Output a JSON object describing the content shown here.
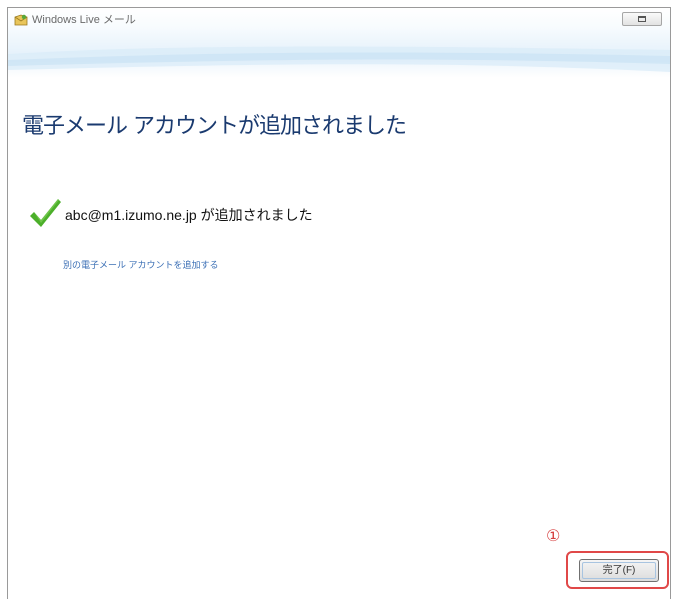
{
  "window": {
    "title": "Windows Live メール"
  },
  "content": {
    "heading": "電子メール アカウントが追加されました",
    "message": "abc@m1.izumo.ne.jp が追加されました",
    "add_account_link": "別の電子メール アカウントを追加する"
  },
  "footer": {
    "step_marker": "①",
    "finish_label": "完了(F)"
  },
  "colors": {
    "heading": "#1a3a6f",
    "link": "#3b6fb5",
    "highlight": "#e04848",
    "check": "#4caf2a"
  },
  "icons": {
    "app": "windows-live-mail-icon",
    "maximize": "maximize-icon",
    "success": "checkmark-icon"
  }
}
